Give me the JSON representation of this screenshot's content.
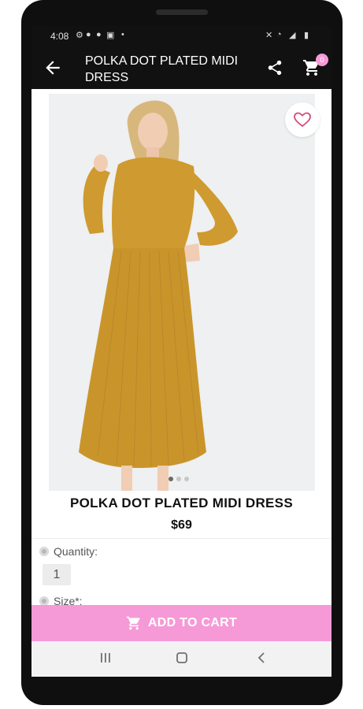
{
  "status_bar": {
    "time": "4:08",
    "left_icons": [
      "settings-icon",
      "github-icon",
      "facebook-icon",
      "gallery-icon",
      "dot"
    ],
    "right_icons": [
      "mute-icon",
      "wifi-icon",
      "signal-icon",
      "battery-icon"
    ]
  },
  "app_bar": {
    "title": "POLKA DOT PLATED MIDI DRESS",
    "cart_count": "0",
    "icons": [
      "back-arrow-icon",
      "share-icon",
      "cart-icon"
    ]
  },
  "product": {
    "name": "POLKA DOT PLATED MIDI DRESS",
    "price": "$69",
    "image_slides": {
      "count": 3,
      "active_index": 0
    },
    "dress_color": "#cf9a2f"
  },
  "options": [
    {
      "label": "Quantity:",
      "value": "1"
    },
    {
      "label": "Size*:"
    }
  ],
  "cta": {
    "label": "ADD TO CART",
    "color": "#f69ad7"
  },
  "nav": {
    "icons": [
      "recent-apps-icon",
      "home-icon",
      "back-icon"
    ]
  }
}
